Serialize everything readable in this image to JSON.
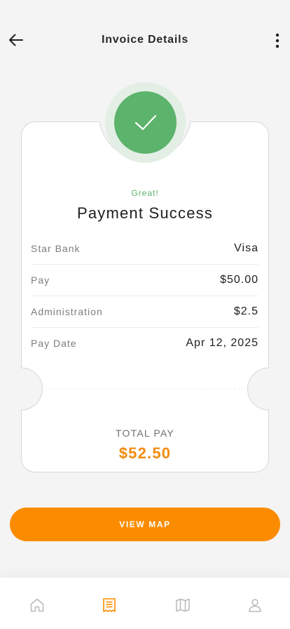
{
  "header": {
    "title": "Invoice Details",
    "back_icon": "arrow-left-icon",
    "more_icon": "more-vertical-icon"
  },
  "status": {
    "icon": "check-icon",
    "subtitle": "Great!",
    "title": "Payment Success"
  },
  "details": [
    {
      "label": "Star Bank",
      "value": "Visa"
    },
    {
      "label": "Pay",
      "value": "$50.00"
    },
    {
      "label": "Administration",
      "value": "$2.5"
    },
    {
      "label": "Pay Date",
      "value": "Apr 12, 2025"
    }
  ],
  "total": {
    "label": "TOTAL PAY",
    "amount": "$52.50"
  },
  "cta": {
    "label": "VIEW MAP"
  },
  "bottom_nav": [
    {
      "name": "home",
      "icon": "home-icon",
      "active": false
    },
    {
      "name": "invoices",
      "icon": "receipt-icon",
      "active": true
    },
    {
      "name": "map",
      "icon": "map-icon",
      "active": false
    },
    {
      "name": "profile",
      "icon": "user-icon",
      "active": false
    }
  ],
  "colors": {
    "accent": "#fb8c00",
    "success": "#5cb36b",
    "success_ring": "#e3efe4",
    "background": "#f4f4f4",
    "nav_inactive": "#b8b8b8"
  }
}
